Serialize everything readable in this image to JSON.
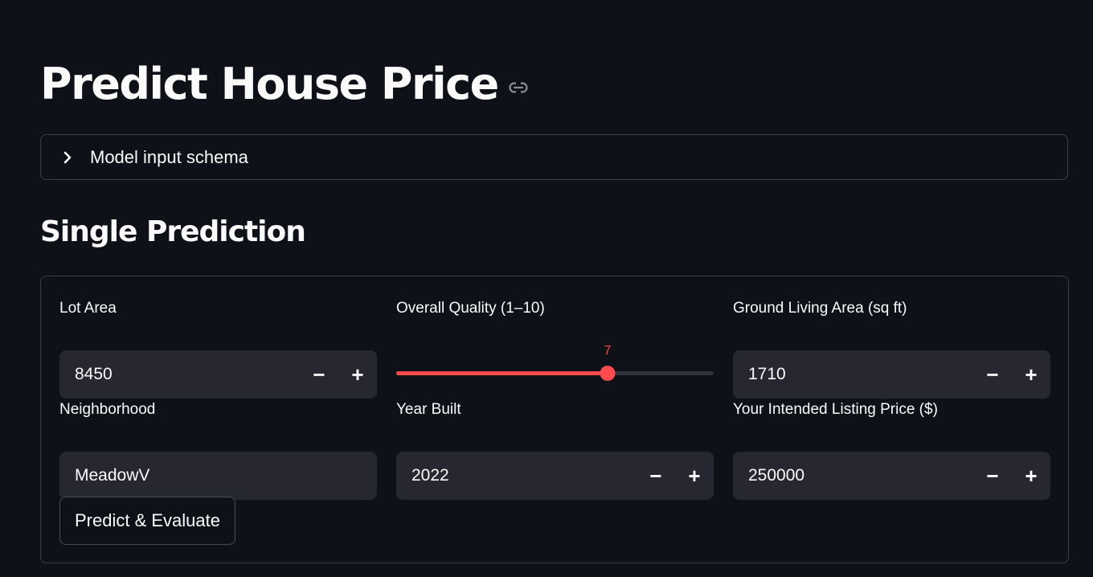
{
  "page": {
    "title": "Predict House Price"
  },
  "expander": {
    "label": "Model input schema",
    "expanded": false
  },
  "section": {
    "title": "Single Prediction"
  },
  "form": {
    "lot_area": {
      "label": "Lot Area",
      "value": "8450",
      "decrement": "−",
      "increment": "+"
    },
    "overall_quality": {
      "label": "Overall Quality (1–10)",
      "value": 7,
      "min": 1,
      "max": 10,
      "display": "7"
    },
    "ground_living_area": {
      "label": "Ground Living Area (sq ft)",
      "value": "1710",
      "decrement": "−",
      "increment": "+"
    },
    "neighborhood": {
      "label": "Neighborhood",
      "value": "MeadowV"
    },
    "year_built": {
      "label": "Year Built",
      "value": "2022",
      "decrement": "−",
      "increment": "+"
    },
    "listing_price": {
      "label": "Your Intended Listing Price ($)",
      "value": "250000",
      "decrement": "−",
      "increment": "+"
    },
    "submit_label": "Predict & Evaluate"
  },
  "colors": {
    "background": "#0e1117",
    "input_bg": "#262730",
    "accent": "#ff4b4b",
    "border": "#3a3d46",
    "text": "#fafafa"
  },
  "icons": {
    "title_link": "link-icon",
    "expander": "chevron-right-icon"
  }
}
